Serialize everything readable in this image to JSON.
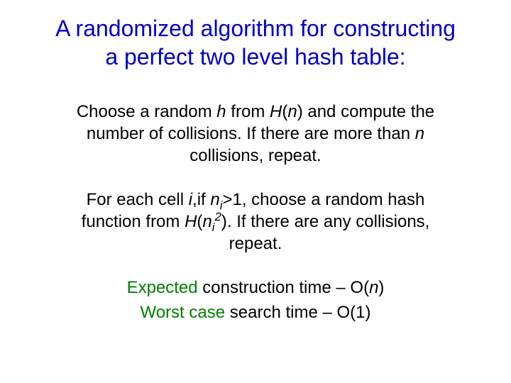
{
  "title": {
    "line1": "A randomized algorithm for constructing",
    "line2": "a perfect two level hash table:"
  },
  "para1": {
    "t1": "Choose a random ",
    "h": "h",
    "t2": " from ",
    "H": "H",
    "lp": "(",
    "n": "n",
    "rp": ")",
    "t3": " and compute the number of collisions. If there are more than ",
    "n2": "n",
    "t4": " collisions, repeat."
  },
  "para2": {
    "t1": "For each cell ",
    "i": "i",
    "comma": ",",
    "t2": "if ",
    "nivar": "n",
    "isub": "i",
    "t3": ">1, choose a random hash function from ",
    "H": "H",
    "lp": "(",
    "n2": "n",
    "isub2": "i",
    "sq": "2",
    "rp": ")",
    "t4": ". If there are any collisions, repeat."
  },
  "results": {
    "line1_green": "Expected",
    "line1_rest": " construction time – O(",
    "line1_n": "n",
    "line1_close": ")",
    "line2_green": "Worst case",
    "line2_rest": " search time – O(1)"
  }
}
